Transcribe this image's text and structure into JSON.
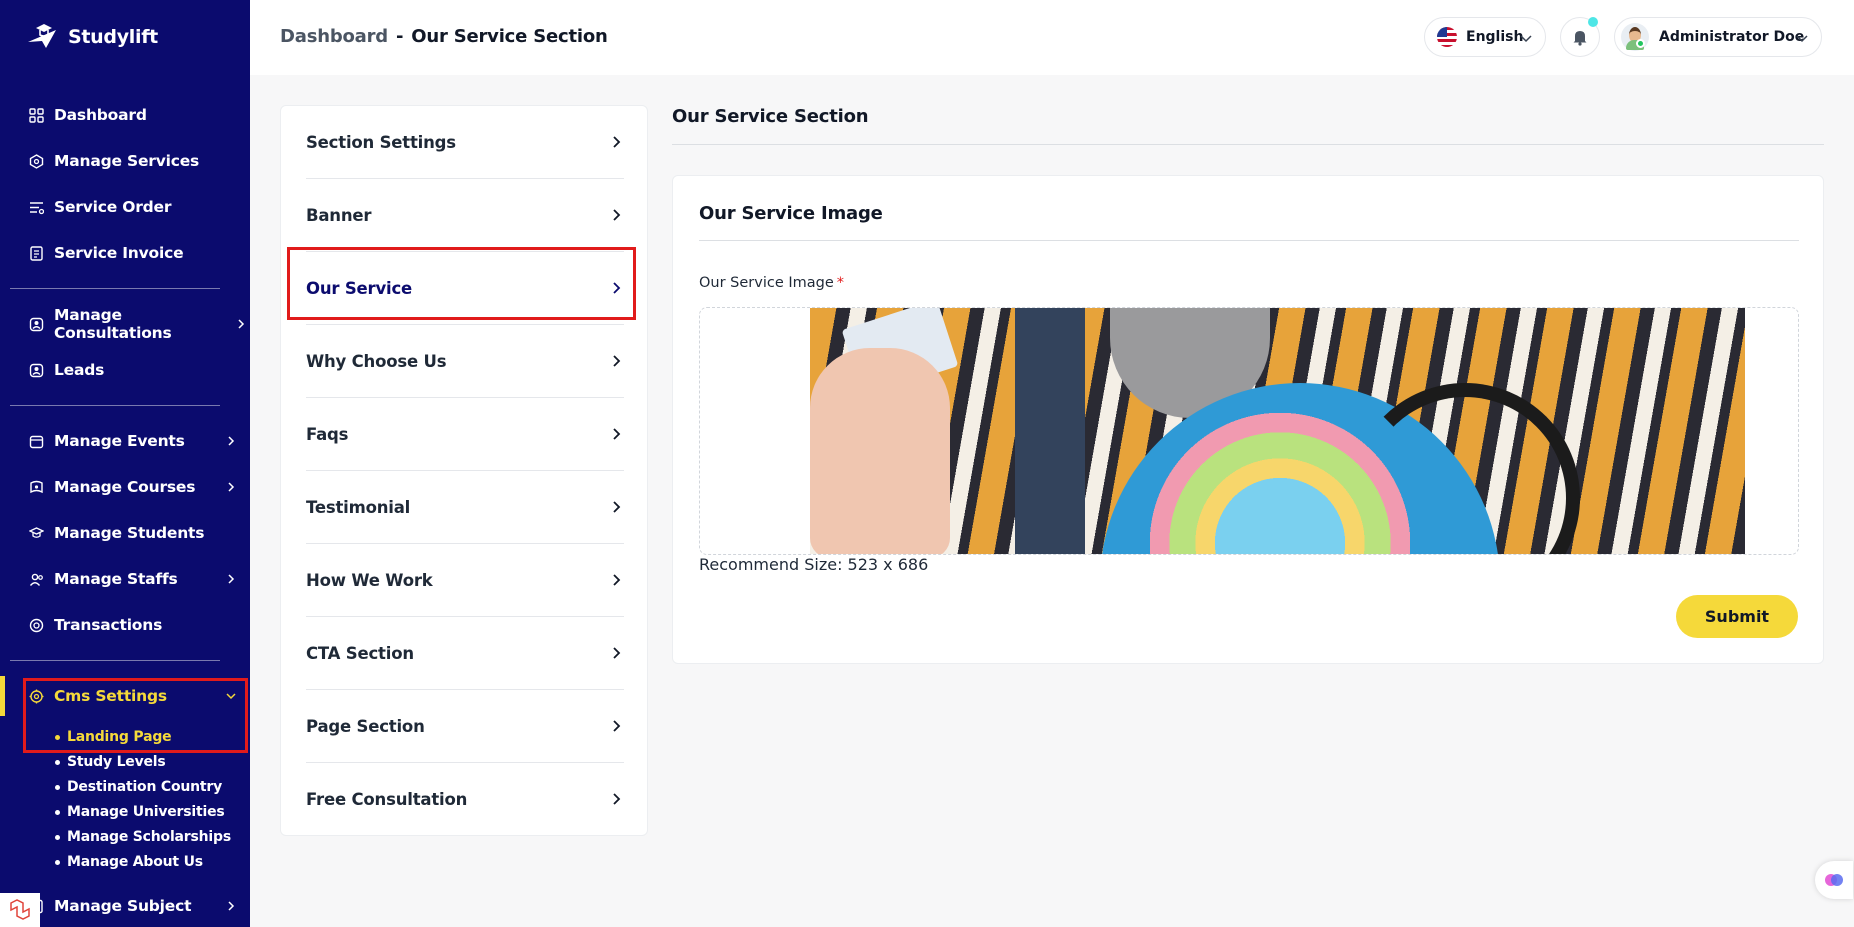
{
  "brand": {
    "name": "Studylift"
  },
  "sidebar": {
    "items": [
      {
        "label": "Dashboard",
        "icon": "grid-icon"
      },
      {
        "label": "Manage Services",
        "icon": "services-icon"
      },
      {
        "label": "Service Order",
        "icon": "list-icon"
      },
      {
        "label": "Service Invoice",
        "icon": "invoice-icon"
      },
      {
        "label": "Manage Consultations",
        "icon": "consultation-icon"
      },
      {
        "label": "Leads",
        "icon": "leads-icon"
      },
      {
        "label": "Manage Events",
        "icon": "calendar-icon"
      },
      {
        "label": "Manage Courses",
        "icon": "courses-icon"
      },
      {
        "label": "Manage Students",
        "icon": "students-icon"
      },
      {
        "label": "Manage Staffs",
        "icon": "staffs-icon"
      },
      {
        "label": "Transactions",
        "icon": "transactions-icon"
      },
      {
        "label": "Cms Settings",
        "icon": "cms-icon"
      },
      {
        "label": "Manage Subject",
        "icon": "subject-icon"
      }
    ],
    "cms_sub": [
      {
        "label": "Landing Page"
      },
      {
        "label": "Study Levels"
      },
      {
        "label": "Destination Country"
      },
      {
        "label": "Manage Universities"
      },
      {
        "label": "Manage Scholarships"
      },
      {
        "label": "Manage About Us"
      }
    ]
  },
  "header": {
    "breadcrumb_root": "Dashboard",
    "breadcrumb_sep": "-",
    "breadcrumb_current": "Our Service Section",
    "language": "English",
    "user_name": "Administrator Doe"
  },
  "sections": [
    {
      "label": "Section Settings"
    },
    {
      "label": "Banner"
    },
    {
      "label": "Our Service"
    },
    {
      "label": "Why Choose Us"
    },
    {
      "label": "Faqs"
    },
    {
      "label": "Testimonial"
    },
    {
      "label": "How We Work"
    },
    {
      "label": "CTA Section"
    },
    {
      "label": "Page Section"
    },
    {
      "label": "Free Consultation"
    }
  ],
  "main": {
    "title": "Our Service Section",
    "card_title": "Our Service Image",
    "field_label": "Our Service Image",
    "required_mark": "*",
    "recommend": "Recommend Size: 523 x 686",
    "submit_label": "Submit"
  },
  "colors": {
    "sidebar_bg": "#0b0b6e",
    "accent_yellow": "#f5d93a",
    "highlight_red": "#e11b1b"
  }
}
